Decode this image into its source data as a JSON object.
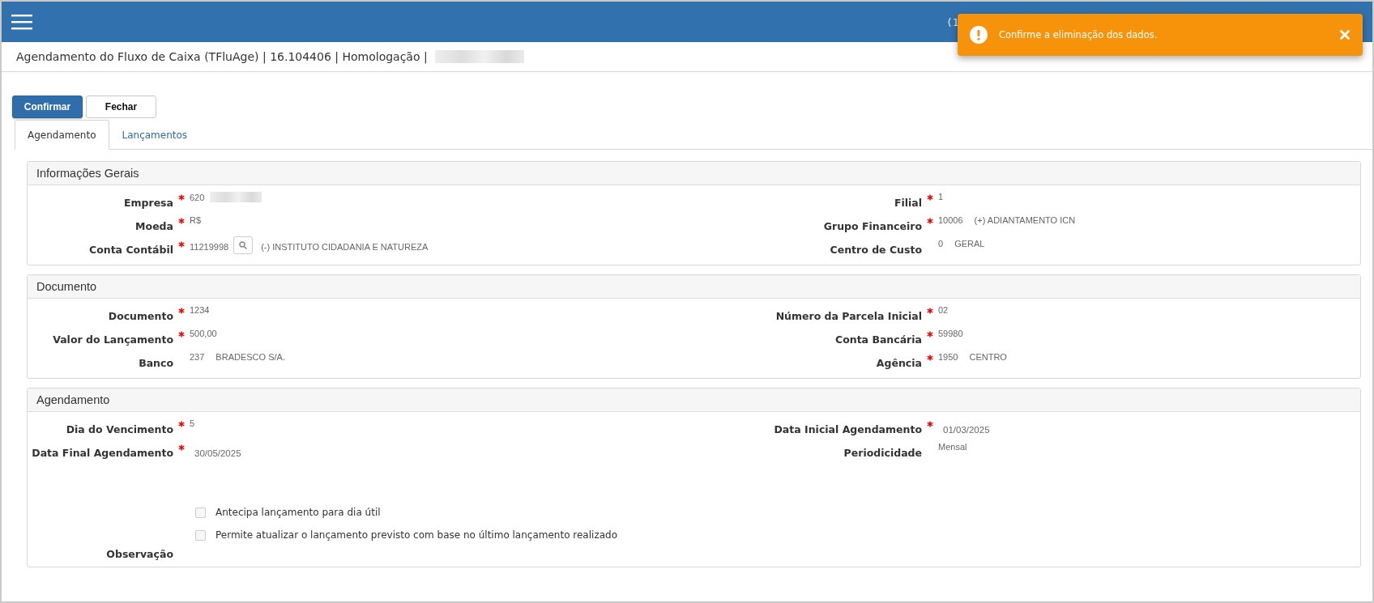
{
  "header": {
    "partial_text": "(1"
  },
  "page_title": {
    "text": "Agendamento do Fluxo de Caixa (TFluAge) | 16.104406 | Homologação |",
    "redacted": true
  },
  "buttons": [
    {
      "label": "Confirmar",
      "kind": "primary"
    },
    {
      "label": "Fechar",
      "kind": "default"
    }
  ],
  "tabs": [
    {
      "label": "Agendamento",
      "selected": true
    },
    {
      "label": "Lançamentos",
      "selected": false
    }
  ],
  "sections": [
    {
      "title": "Informações Gerais",
      "left": [
        {
          "label": "Empresa",
          "required": true,
          "code": "620",
          "redacted": true
        },
        {
          "label": "Moeda",
          "required": true,
          "code": "R$"
        },
        {
          "label": "Conta Contábil",
          "required": true,
          "code": "11219998",
          "kind": "lookup",
          "description": "(-) INSTITUTO CIDADANIA E NATUREZA"
        }
      ],
      "right": [
        {
          "label": "Filial",
          "required": true,
          "code": "1"
        },
        {
          "label": "Grupo Financeiro",
          "required": true,
          "code": "10006",
          "description": "(+) ADIANTAMENTO ICN"
        },
        {
          "label": "Centro de Custo",
          "required": false,
          "code": "0",
          "description": "GERAL"
        }
      ]
    },
    {
      "title": "Documento",
      "left": [
        {
          "label": "Documento",
          "required": true,
          "code": "1234"
        },
        {
          "label": "Valor do Lançamento",
          "required": true,
          "code": "500,00"
        },
        {
          "label": "Banco",
          "required": false,
          "code": "237",
          "description": "BRADESCO S/A."
        }
      ],
      "right": [
        {
          "label": "Número da Parcela Inicial",
          "required": true,
          "code": "02"
        },
        {
          "label": "Conta Bancária",
          "required": true,
          "code": "59980"
        },
        {
          "label": "Agência",
          "required": true,
          "code": "1950",
          "description": "CENTRO"
        }
      ]
    },
    {
      "title": "Agendamento",
      "left": [
        {
          "label": "Dia do Vencimento",
          "required": true,
          "code": "5"
        },
        {
          "label": "Data Final Agendamento",
          "required": true,
          "code": "30/05/2025",
          "kind": "date"
        }
      ],
      "right": [
        {
          "label": "Data Inicial Agendamento",
          "required": true,
          "code": "01/03/2025",
          "kind": "date"
        },
        {
          "label": "Periodicidade",
          "required": false,
          "code": "Mensal"
        }
      ],
      "checkboxes": [
        {
          "label": "Antecipa lançamento para dia útil",
          "checked": false
        },
        {
          "label": "Permite atualizar o lançamento previsto com base no último lançamento realizado",
          "checked": false
        }
      ],
      "footer_field": {
        "label": "Observação"
      }
    }
  ],
  "toast": {
    "message": "Confirme a eliminação dos dados.",
    "kind": "warning"
  }
}
